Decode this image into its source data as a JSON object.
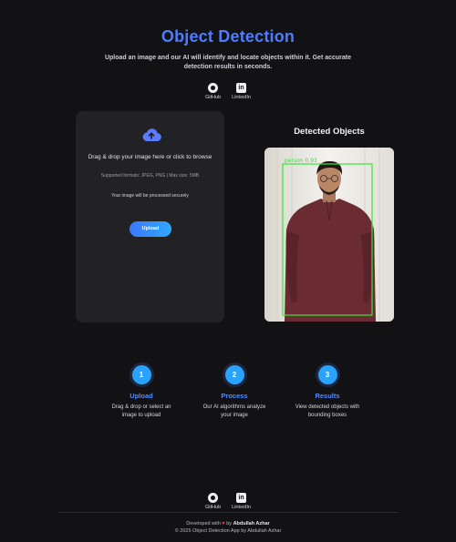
{
  "header": {
    "title": "Object Detection",
    "subtitle": "Upload an image and our AI will identify and locate objects within it. Get accurate detection results in seconds.",
    "social": [
      {
        "label": "GitHub",
        "icon": "github-icon"
      },
      {
        "label": "LinkedIn",
        "icon": "linkedin-icon"
      }
    ]
  },
  "upload": {
    "icon": "cloud-upload-icon",
    "drag_text": "Drag & drop your image here or click to browse",
    "formats": "Supported formats: JPEG, PNG | Max size: 5MB",
    "secure": "Your image will be processed securely",
    "button": "Upload"
  },
  "results": {
    "title": "Detected Objects",
    "box_label": "person 0.93"
  },
  "steps": [
    {
      "num": "1",
      "title": "Upload",
      "desc": "Drag & drop or select an image to upload"
    },
    {
      "num": "2",
      "title": "Process",
      "desc": "Our AI algorithms analyze your image"
    },
    {
      "num": "3",
      "title": "Results",
      "desc": "View detected objects with bounding boxes"
    }
  ],
  "footer": {
    "social": [
      {
        "label": "GitHub",
        "icon": "github-icon"
      },
      {
        "label": "LinkedIn",
        "icon": "linkedin-icon"
      }
    ],
    "dev_prefix": "Developed with",
    "heart": "♥",
    "dev_by": "by",
    "dev_name": "Abdullah Azhar",
    "copyright": "© 2025 Object Detection App by Abdullah Azhar"
  },
  "colors": {
    "background": "#121214",
    "accent": "#4f7cff",
    "button": "#2aa3ff",
    "detection_box": "#39e639"
  }
}
